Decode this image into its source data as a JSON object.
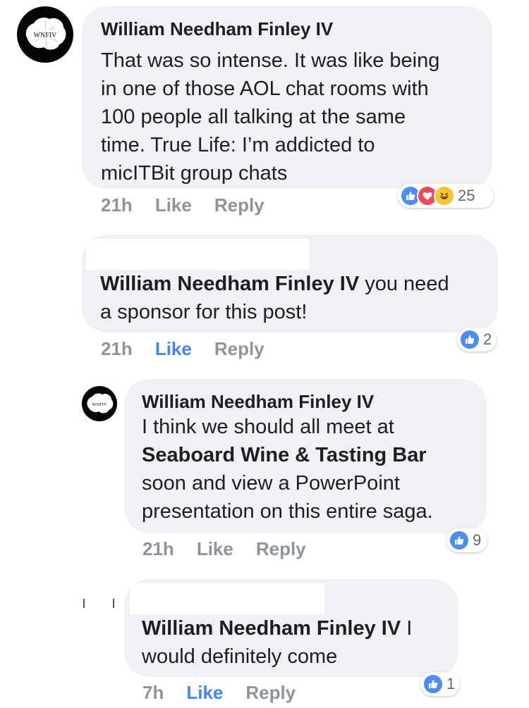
{
  "comments": [
    {
      "author": "William Needham Finley IV",
      "avatar_text": "WNFIV",
      "lines": [
        "That was so intense. It was like being",
        "in one of those AOL chat rooms with",
        "100 people all talking at the same",
        "time. True Life: I’m addicted to",
        "micITBit group chats"
      ],
      "time": "21h",
      "like": "Like",
      "reply": "Reply",
      "reaction_count": "25",
      "reactions": [
        "like-icon",
        "love-icon",
        "haha-icon"
      ]
    },
    {
      "mention": "William Needham Finley IV",
      "line1_rest": " you need",
      "line2": "a sponsor for this post!",
      "time": "21h",
      "like": "Like",
      "reply": "Reply",
      "reaction_count": "2",
      "like_active": true
    },
    {
      "author": "William Needham Finley IV",
      "avatar_text": "WNFIV",
      "line1": "I think we should all meet at",
      "place": "Seaboard Wine & Tasting Bar",
      "line3": "soon and view a PowerPoint",
      "line4": "presentation on this entire saga.",
      "time": "21h",
      "like": "Like",
      "reply": "Reply",
      "reaction_count": "9"
    },
    {
      "mention": "William Needham Finley IV",
      "line1_rest": "  I",
      "line2": "would definitely come",
      "time": "7h",
      "like": "Like",
      "reply": "Reply",
      "reaction_count": "1",
      "like_active": true
    }
  ],
  "colors": {
    "bubble": "#f0f1f4",
    "meta": "#8d949e",
    "like_active": "#4285f4",
    "like_icon": "#4b8ef0",
    "love_icon": "#f0485c",
    "haha_icon": "#f7c534"
  }
}
